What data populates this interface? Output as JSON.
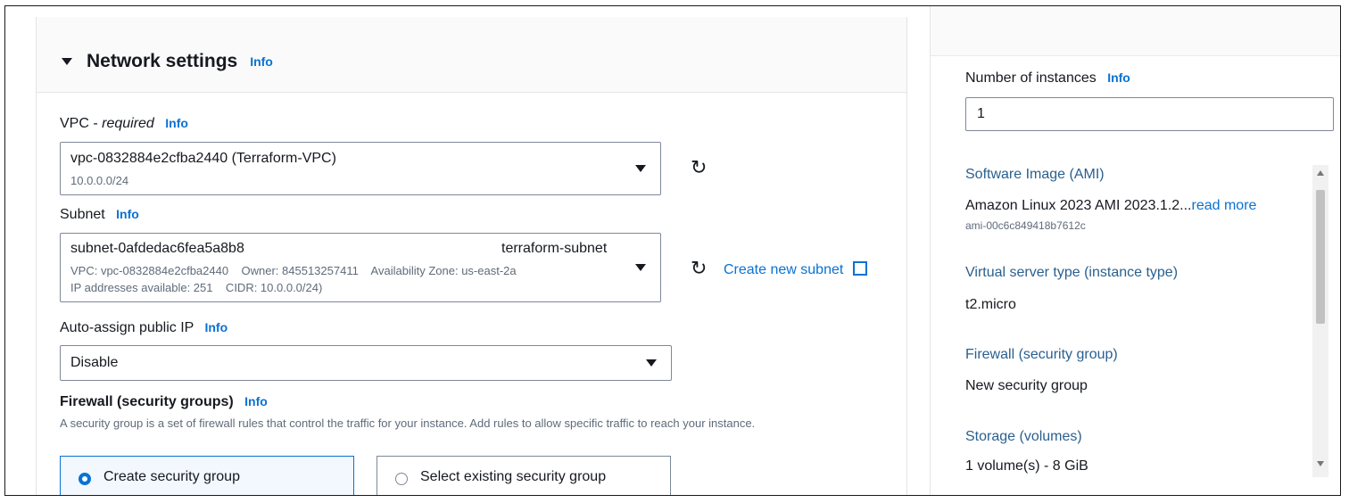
{
  "network": {
    "title": "Network settings",
    "info": "Info",
    "vpc": {
      "label": "VPC - ",
      "label_required": "required",
      "info": "Info",
      "value": "vpc-0832884e2cfba2440 (Terraform-VPC)",
      "cidr": "10.0.0.0/24"
    },
    "subnet": {
      "label": "Subnet",
      "info": "Info",
      "id": "subnet-0afdedac6fea5a8b8",
      "name": "terraform-subnet",
      "line2": "VPC: vpc-0832884e2cfba2440    Owner: 845513257411    Availability Zone: us-east-2a",
      "line3": "IP addresses available: 251    CIDR: 10.0.0.0/24)",
      "create_link": "Create new subnet"
    },
    "public_ip": {
      "label": "Auto-assign public IP",
      "info": "Info",
      "value": "Disable"
    },
    "firewall": {
      "label": "Firewall (security groups)",
      "info": "Info",
      "description": "A security group is a set of firewall rules that control the traffic for your instance. Add rules to allow specific traffic to reach your instance.",
      "option_create": "Create security group",
      "option_existing": "Select existing security group"
    }
  },
  "summary": {
    "instances_label": "Number of instances",
    "instances_info": "Info",
    "instances_value": "1",
    "ami_label": "Software Image (AMI)",
    "ami_value": "Amazon Linux 2023 AMI 2023.1.2...",
    "ami_read_more": "read more",
    "ami_id": "ami-00c6c849418b7612c",
    "type_label": "Virtual server type (instance type)",
    "type_value": "t2.micro",
    "firewall_label": "Firewall (security group)",
    "firewall_value": "New security group",
    "storage_label": "Storage (volumes)",
    "storage_value": "1 volume(s) - 8 GiB"
  },
  "colors": {
    "link": "#0972d3",
    "text": "#16191f",
    "selected_border": "#0972d3",
    "selected_bg": "#f2f8fd"
  }
}
